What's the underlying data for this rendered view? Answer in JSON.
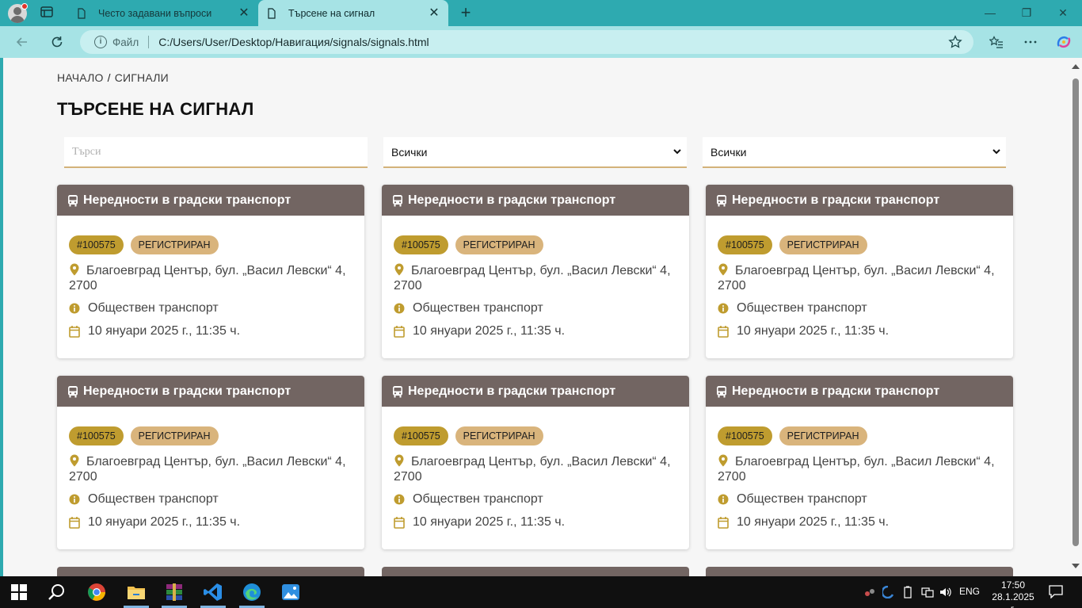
{
  "browser": {
    "tabs": [
      {
        "title": "Често задавани въпроси"
      },
      {
        "title": "Търсене на сигнал"
      }
    ],
    "address": {
      "scheme_label": "Файл",
      "url": "C:/Users/User/Desktop/Навигация/signals/signals.html"
    }
  },
  "page": {
    "breadcrumb": {
      "home": "НАЧАЛО",
      "separator": "/",
      "current": "СИГНАЛИ"
    },
    "title": "ТЪРСЕНЕ НА СИГНАЛ",
    "filters": {
      "search_placeholder": "Търси",
      "select1_value": "Всички",
      "select2_value": "Всички"
    },
    "cards": [
      {
        "title": "Нередности в градски транспорт",
        "id": "#100575",
        "status": "РЕГИСТРИРАН",
        "address": "Благоевград Център, бул. „Васил Левски“ 4, 2700",
        "category": "Обществен транспорт",
        "date": "10 януари 2025 г., 11:35 ч."
      },
      {
        "title": "Нередности в градски транспорт",
        "id": "#100575",
        "status": "РЕГИСТРИРАН",
        "address": "Благоевград Център, бул. „Васил Левски“ 4, 2700",
        "category": "Обществен транспорт",
        "date": "10 януари 2025 г., 11:35 ч."
      },
      {
        "title": "Нередности в градски транспорт",
        "id": "#100575",
        "status": "РЕГИСТРИРАН",
        "address": "Благоевград Център, бул. „Васил Левски“ 4, 2700",
        "category": "Обществен транспорт",
        "date": "10 януари 2025 г., 11:35 ч."
      },
      {
        "title": "Нередности в градски транспорт",
        "id": "#100575",
        "status": "РЕГИСТРИРАН",
        "address": "Благоевград Център, бул. „Васил Левски“ 4, 2700",
        "category": "Обществен транспорт",
        "date": "10 януари 2025 г., 11:35 ч."
      },
      {
        "title": "Нередности в градски транспорт",
        "id": "#100575",
        "status": "РЕГИСТРИРАН",
        "address": "Благоевград Център, бул. „Васил Левски“ 4, 2700",
        "category": "Обществен транспорт",
        "date": "10 януари 2025 г., 11:35 ч."
      },
      {
        "title": "Нередности в градски транспорт",
        "id": "#100575",
        "status": "РЕГИСТРИРАН",
        "address": "Благоевград Център, бул. „Васил Левски“ 4, 2700",
        "category": "Обществен транспорт",
        "date": "10 януари 2025 г., 11:35 ч."
      }
    ]
  },
  "taskbar": {
    "language": "ENG",
    "time": "17:50",
    "date": "28.1.2025 г."
  },
  "colors": {
    "accent_browser": "#2eaab0",
    "card_header": "#726562",
    "badge_id": "#bf9c2f",
    "badge_status": "#d9b47c",
    "icon_gold": "#bf9c2f"
  }
}
